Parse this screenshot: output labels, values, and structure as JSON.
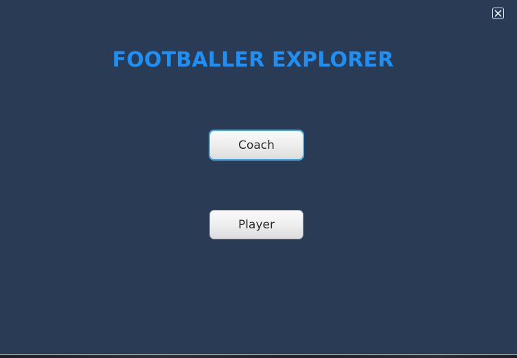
{
  "window": {
    "title": "FOOTBALLER EXPLORER",
    "close_icon": "close-icon"
  },
  "buttons": {
    "coach_label": "Coach",
    "player_label": "Player"
  },
  "colors": {
    "background": "#2a3c55",
    "title": "#1e8ff5",
    "focus_ring": "#2fa8e6"
  }
}
